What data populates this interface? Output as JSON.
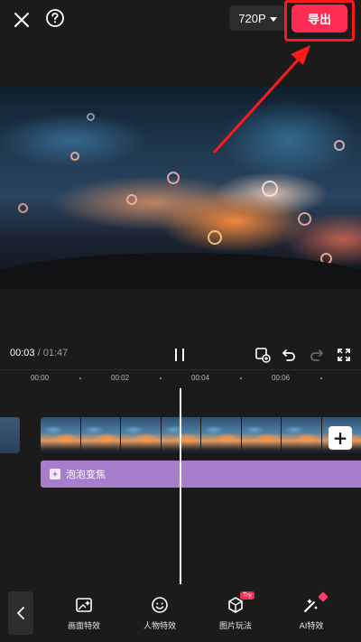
{
  "topbar": {
    "close_icon": "close-icon",
    "help_icon": "help-icon",
    "resolution": "720P",
    "export_label": "导出"
  },
  "player": {
    "current_time": "00:03",
    "separator": "/",
    "duration": "01:47"
  },
  "timeline": {
    "ticks": [
      "00:00",
      "00:02",
      "00:04",
      "00:06"
    ],
    "effect_label": "泡泡变焦"
  },
  "toolbar": {
    "items": [
      {
        "label": "画面特效",
        "icon": "frame-effect-icon"
      },
      {
        "label": "人物特效",
        "icon": "face-effect-icon"
      },
      {
        "label": "图片玩法",
        "icon": "cube-icon",
        "badge": "Try"
      },
      {
        "label": "AI特效",
        "icon": "magic-wand-icon"
      }
    ]
  },
  "colors": {
    "accent": "#fe2c55",
    "effect_track": "#a67ecb",
    "annotation": "#ff1a1a",
    "background": "#1b1b1b"
  }
}
